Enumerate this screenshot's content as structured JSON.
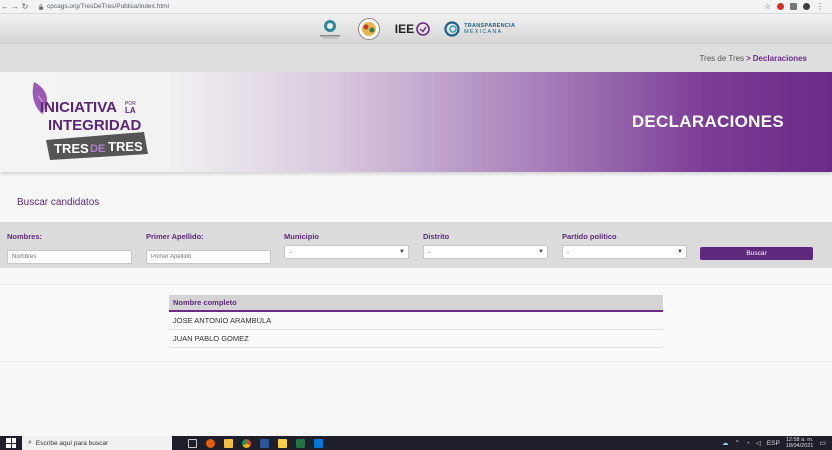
{
  "browser": {
    "url": "cpcags.org/TresDeTres/Publica/index.html",
    "back_icon": "←",
    "forward_icon": "→",
    "reload_icon": "↻"
  },
  "logos": {
    "iee_text": "IEE",
    "transparencia_line1": "TRANSPARENCIA",
    "transparencia_line2": "MEXICANA"
  },
  "breadcrumb": {
    "parent": "Tres de Tres",
    "separator": ">",
    "current": "Declaraciones"
  },
  "banner": {
    "brand_line1": "INICIATIVA",
    "brand_por": "POR",
    "brand_la": "LA",
    "brand_line2": "INTEGRIDAD",
    "brand_line3a": "TRES",
    "brand_line3b": "DE",
    "brand_line3c": "TRES",
    "title": "DECLARACIONES"
  },
  "search": {
    "heading": "Buscar candidatos",
    "nombres_label": "Nombres:",
    "nombres_placeholder": "Nombres",
    "apellido_label": "Primer Apellido:",
    "apellido_placeholder": "Primer Apellido",
    "municipio_label": "Municipio",
    "municipio_value": "-",
    "distrito_label": "Distrito",
    "distrito_value": "-",
    "partido_label": "Partido político",
    "partido_value": "-",
    "button_label": "Buscar"
  },
  "results": {
    "column_header": "Nombre completo",
    "rows": [
      "JOSE ANTONIO ARAMBULA",
      "JUAN PABLO GOMEZ"
    ]
  },
  "taskbar": {
    "search_placeholder": "Escribe aquí para buscar",
    "language": "ESP",
    "time": "12:58 a. m.",
    "date": "18/04/2021"
  },
  "colors": {
    "brand_purple": "#6b2a86",
    "heading_purple": "#5c2a7c"
  }
}
